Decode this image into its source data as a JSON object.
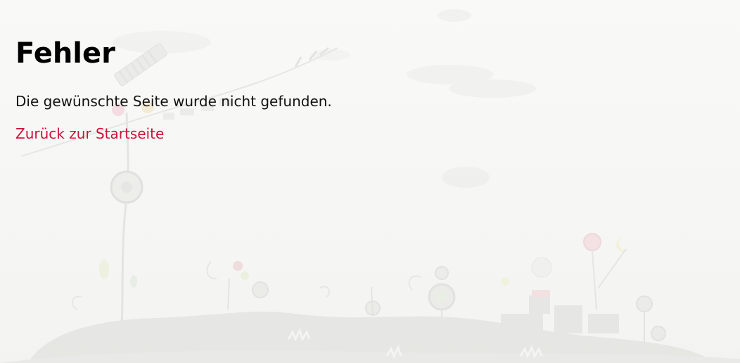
{
  "error": {
    "title": "Fehler",
    "message": "Die gewünschte Seite wurde nicht gefunden.",
    "home_link": "Zurück zur Startseite"
  },
  "colors": {
    "link": "#d0103a",
    "background": "#f7f7f5"
  }
}
